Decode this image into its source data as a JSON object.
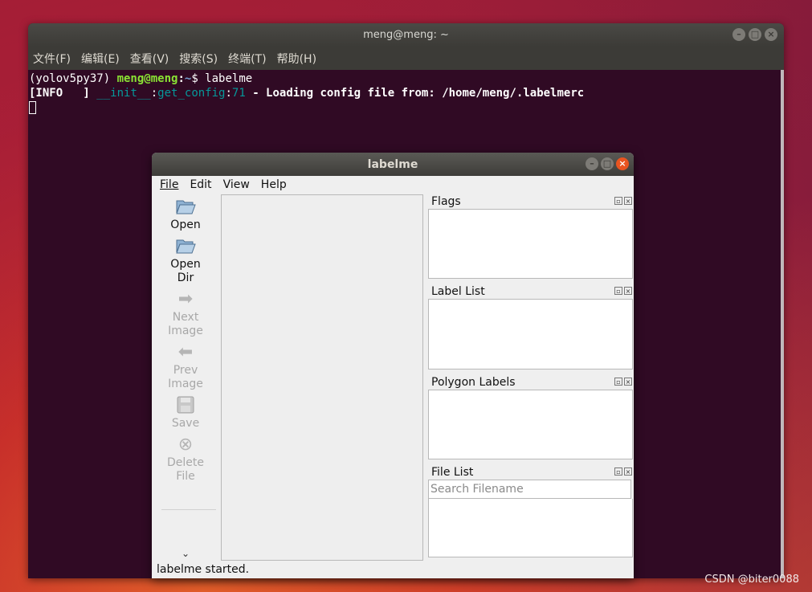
{
  "terminal": {
    "title": "meng@meng: ~",
    "menu": [
      "文件(F)",
      "编辑(E)",
      "查看(V)",
      "搜索(S)",
      "终端(T)",
      "帮助(H)"
    ],
    "line1": {
      "env": "(yolov5py37) ",
      "user_host": "meng@meng",
      "sep": ":",
      "path": "~",
      "prompt": "$ labelme"
    },
    "line2": {
      "level": "[INFO   ] ",
      "module": "__init__",
      "c1": ":",
      "func": "get_config",
      "c2": ":",
      "lineno": "71",
      "message": " - Loading config file from: /home/meng/.labelmerc"
    }
  },
  "labelme": {
    "title": "labelme",
    "menu": [
      "File",
      "Edit",
      "View",
      "Help"
    ],
    "tools": [
      {
        "label": "Open",
        "icon": "folder-open-icon",
        "enabled": true
      },
      {
        "label": "Open\nDir",
        "icon": "folder-open-icon",
        "enabled": true
      },
      {
        "label": "Next\nImage",
        "icon": "arrow-right-icon",
        "enabled": false
      },
      {
        "label": "Prev\nImage",
        "icon": "arrow-left-icon",
        "enabled": false
      },
      {
        "label": "Save",
        "icon": "floppy-disk-icon",
        "enabled": false
      },
      {
        "label": "Delete\nFile",
        "icon": "delete-circle-icon",
        "enabled": false
      }
    ],
    "docks": {
      "flags": "Flags",
      "label_list": "Label List",
      "polygon_labels": "Polygon Labels",
      "file_list": "File List"
    },
    "search_placeholder": "Search Filename",
    "status": "labelme started."
  },
  "watermark": "CSDN @biter0088",
  "colors": {
    "accent": "#e95420",
    "terminal_bg": "#300a24"
  }
}
